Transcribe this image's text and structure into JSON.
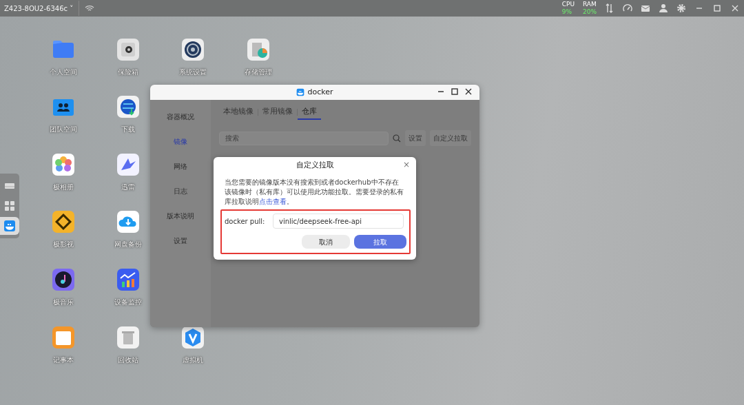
{
  "top_bar": {
    "device_name": "Z423-8OU2-6346c",
    "caret": "˅",
    "cpu": {
      "label": "CPU",
      "value": "9%"
    },
    "ram": {
      "label": "RAM",
      "value": "20%"
    }
  },
  "dock": [
    {
      "kind": "drive",
      "selected": false
    },
    {
      "kind": "apps",
      "selected": false
    },
    {
      "kind": "docker",
      "selected": true
    }
  ],
  "desktop_icons": [
    {
      "label": "个人空间",
      "kind": "folder"
    },
    {
      "label": "保险箱",
      "kind": "safe"
    },
    {
      "label": "系统设置",
      "kind": "settings"
    },
    {
      "label": "存储管理",
      "kind": "storage"
    },
    {
      "label": "团队空间",
      "kind": "team"
    },
    {
      "label": "下载",
      "kind": "download"
    },
    {
      "label": "极相册",
      "kind": "photos"
    },
    {
      "label": "迅雷",
      "kind": "bird"
    },
    {
      "label": "极影视",
      "kind": "video"
    },
    {
      "label": "网盘备份",
      "kind": "cloud"
    },
    {
      "label": "极音乐",
      "kind": "music"
    },
    {
      "label": "设备监控",
      "kind": "monitor"
    },
    {
      "label": "记事本",
      "kind": "notes"
    },
    {
      "label": "回收站",
      "kind": "trash"
    },
    {
      "label": "虚拟机",
      "kind": "vm"
    }
  ],
  "docker_window": {
    "title": "docker",
    "sidebar": [
      {
        "label": "容器概况",
        "selected": false
      },
      {
        "label": "镜像",
        "selected": true
      },
      {
        "label": "网络",
        "selected": false
      },
      {
        "label": "日志",
        "selected": false
      },
      {
        "label": "版本说明",
        "selected": false
      },
      {
        "label": "设置",
        "selected": false
      }
    ],
    "tabs": [
      {
        "label": "本地镜像",
        "selected": false
      },
      {
        "label": "常用镜像",
        "selected": false
      },
      {
        "label": "仓库",
        "selected": true
      }
    ],
    "search": {
      "placeholder": "搜索"
    },
    "buttons": [
      "设置",
      "自定义拉取"
    ],
    "dialog": {
      "title": "自定义拉取",
      "close": "×",
      "description": "当您需要的镜像版本没有搜索到或者dockerhub中不存在该镜像时（私有库）可以使用此功能拉取。需要登录的私有库拉取说明",
      "link": "点击查看",
      "after_link": "。",
      "field_label": "docker pull:",
      "field_value": "vinlic/deepseek-free-api",
      "cancel": "取消",
      "confirm": "拉取"
    }
  }
}
